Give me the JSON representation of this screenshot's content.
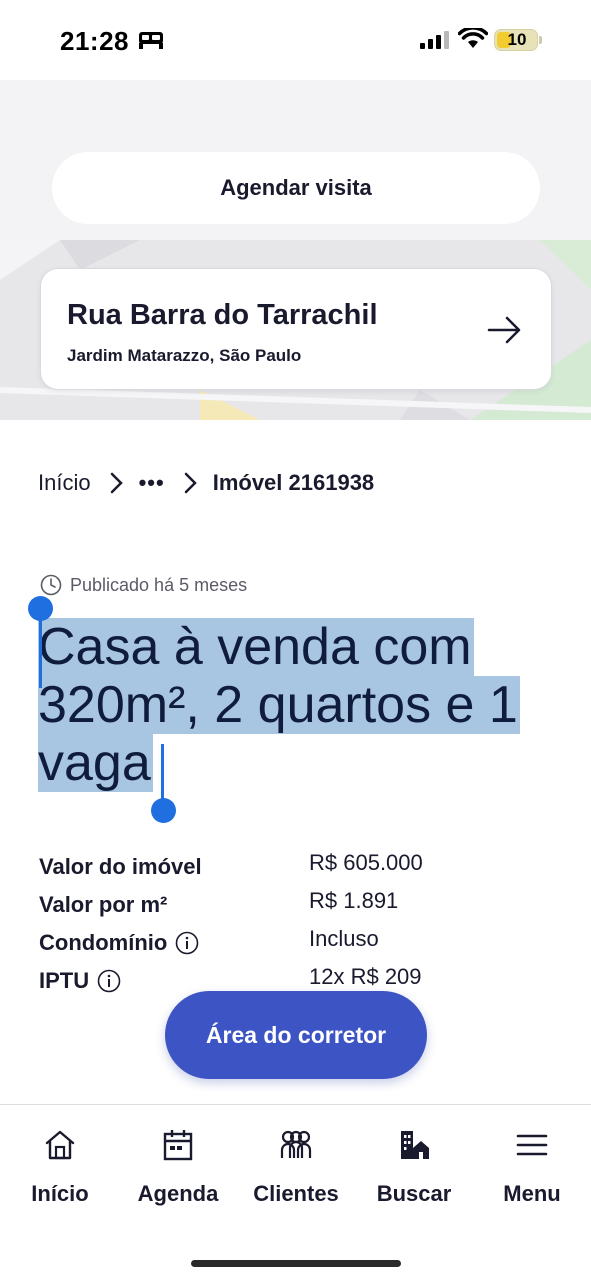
{
  "status_bar": {
    "time": "21:28",
    "battery": "10"
  },
  "schedule": {
    "button_label": "Agendar visita"
  },
  "address": {
    "street": "Rua Barra do Tarrachil",
    "area": "Jardim Matarazzo, São Paulo"
  },
  "breadcrumb": {
    "home": "Início",
    "ellipsis": "•••",
    "current": "Imóvel 2161938"
  },
  "published": "Publicado há 5 meses",
  "title": {
    "line1": "Casa à venda com",
    "line2": "320m², 2 quartos e 1",
    "line3": "vaga"
  },
  "prices": [
    {
      "label": "Valor do imóvel",
      "value": "R$ 605.000",
      "info": false
    },
    {
      "label": "Valor por m²",
      "value": "R$ 1.891",
      "info": false
    },
    {
      "label": "Condomínio",
      "value": "Incluso",
      "info": true
    },
    {
      "label": "IPTU",
      "value": "12x R$ 209",
      "info": true
    }
  ],
  "broker_button": "Área do corretor",
  "nav": [
    {
      "label": "Início",
      "icon": "home-icon"
    },
    {
      "label": "Agenda",
      "icon": "calendar-icon"
    },
    {
      "label": "Clientes",
      "icon": "clients-icon"
    },
    {
      "label": "Buscar",
      "icon": "building-search-icon"
    },
    {
      "label": "Menu",
      "icon": "menu-icon"
    }
  ],
  "colors": {
    "accent": "#3d55c4",
    "selection": "#a8c6e2",
    "handle": "#1f6fe0",
    "text": "#1a1a2e"
  }
}
